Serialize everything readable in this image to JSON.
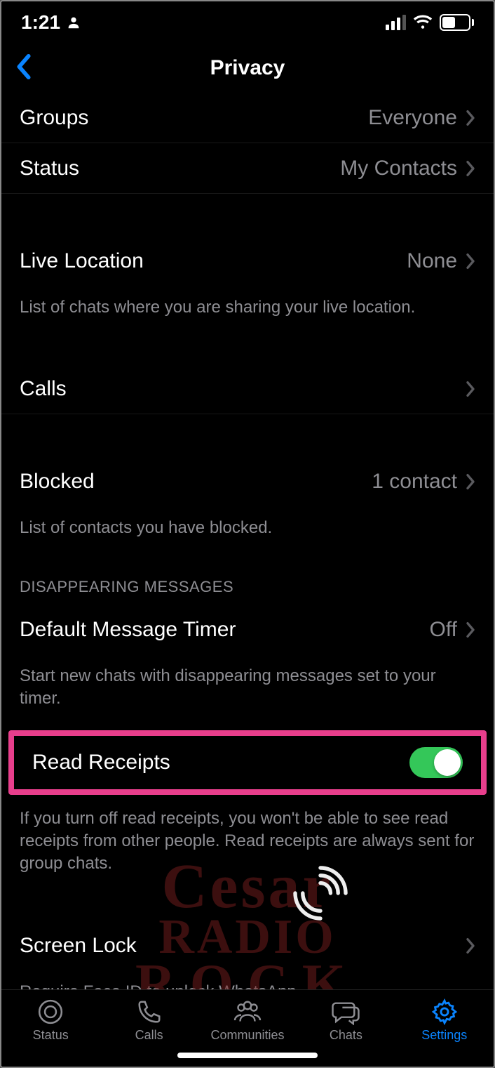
{
  "status": {
    "time": "1:21",
    "battery": "45"
  },
  "nav": {
    "title": "Privacy"
  },
  "rows": {
    "groups": {
      "label": "Groups",
      "value": "Everyone"
    },
    "status": {
      "label": "Status",
      "value": "My Contacts"
    },
    "liveloc": {
      "label": "Live Location",
      "value": "None",
      "note": "List of chats where you are sharing your live location."
    },
    "calls": {
      "label": "Calls"
    },
    "blocked": {
      "label": "Blocked",
      "value": "1 contact",
      "note": "List of contacts you have blocked."
    },
    "disappearing_header": "DISAPPEARING MESSAGES",
    "timer": {
      "label": "Default Message Timer",
      "value": "Off",
      "note": "Start new chats with disappearing messages set to your timer."
    },
    "read": {
      "label": "Read Receipts",
      "note": "If you turn off read receipts, you won't be able to see read receipts from other people. Read receipts are always sent for group chats."
    },
    "screenlock": {
      "label": "Screen Lock",
      "note": "Require Face ID to unlock WhatsApp."
    }
  },
  "tabs": {
    "status": "Status",
    "calls": "Calls",
    "communities": "Communities",
    "chats": "Chats",
    "settings": "Settings"
  },
  "watermark": {
    "l1": "Cesar",
    "l2": "RADIO",
    "l3": "ROCK"
  }
}
